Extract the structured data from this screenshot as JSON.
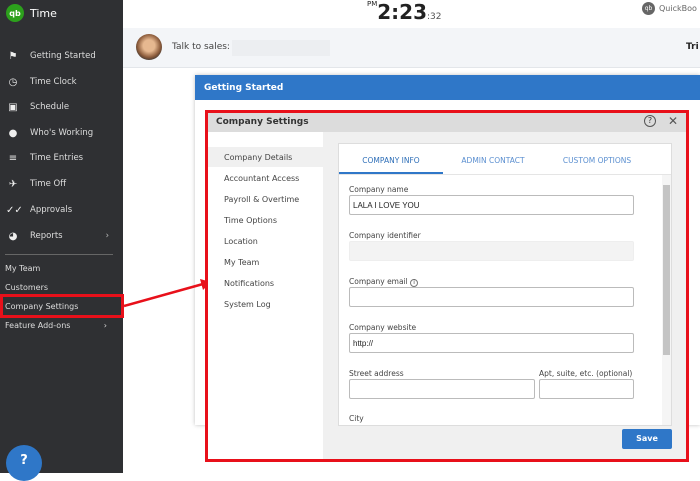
{
  "app": {
    "name": "Time",
    "logo": "qb"
  },
  "sidebar": {
    "items": [
      {
        "label": "Getting Started",
        "icon": "flag-icon"
      },
      {
        "label": "Time Clock",
        "icon": "clock-icon"
      },
      {
        "label": "Schedule",
        "icon": "calendar-icon"
      },
      {
        "label": "Who's Working",
        "icon": "location-pin-icon"
      },
      {
        "label": "Time Entries",
        "icon": "time-entries-icon"
      },
      {
        "label": "Time Off",
        "icon": "airplane-icon"
      },
      {
        "label": "Approvals",
        "icon": "double-check-icon"
      },
      {
        "label": "Reports",
        "icon": "pie-chart-icon"
      }
    ],
    "sub_items": [
      {
        "label": "My Team"
      },
      {
        "label": "Customers"
      },
      {
        "label": "Company Settings"
      },
      {
        "label": "Feature Add-ons"
      }
    ],
    "help_label": "?"
  },
  "header": {
    "clock_ampm": "PM",
    "clock_time": "2:23",
    "clock_seconds": ":32",
    "brand": "QuickBoo",
    "talk_to_sales": "Talk to sales:",
    "trial": "Tri"
  },
  "getting_started": {
    "title": "Getting Started"
  },
  "modal": {
    "title": "Company Settings",
    "nav": [
      "Company Details",
      "Accountant Access",
      "Payroll & Overtime",
      "Time Options",
      "Location",
      "My Team",
      "Notifications",
      "System Log"
    ],
    "tabs": [
      "COMPANY INFO",
      "ADMIN CONTACT",
      "CUSTOM OPTIONS"
    ],
    "fields": {
      "company_name_label": "Company name",
      "company_name_value": "LALA I LOVE YOU",
      "company_identifier_label": "Company identifier",
      "company_email_label": "Company email",
      "company_website_label": "Company website",
      "company_website_value": "http://",
      "street_label": "Street address",
      "apt_label": "Apt, suite, etc. (optional)",
      "city_label": "City"
    },
    "save_label": "Save"
  },
  "colors": {
    "sidebar": "#2f3033",
    "accent": "#2f77c8",
    "highlight": "#e8101a",
    "brand_green": "#2ca01c"
  }
}
